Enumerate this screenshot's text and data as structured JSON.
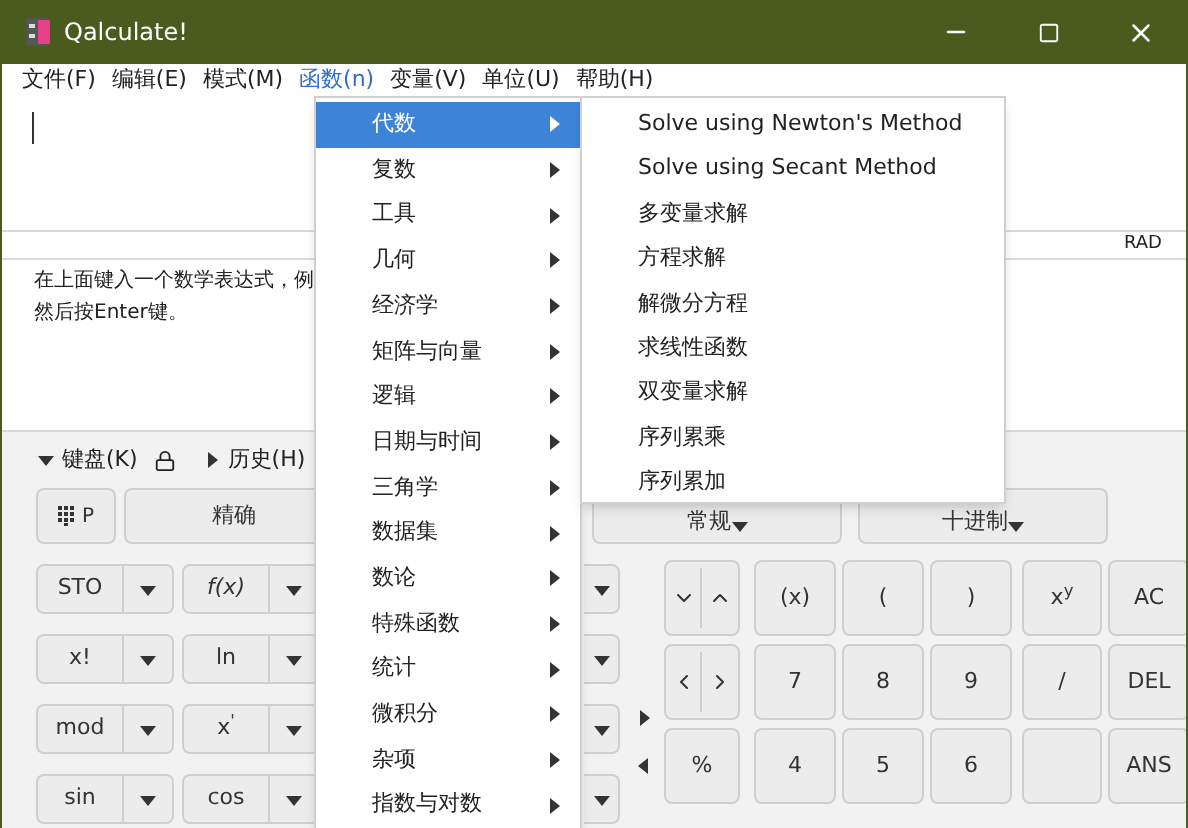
{
  "window": {
    "title": "Qalculate!"
  },
  "menu_bar": [
    {
      "label": "文件(F)",
      "selected": false
    },
    {
      "label": "编辑(E)",
      "selected": false
    },
    {
      "label": "模式(M)",
      "selected": false
    },
    {
      "label": "函数(n)",
      "selected": true
    },
    {
      "label": "变量(V)",
      "selected": false
    },
    {
      "label": "单位(U)",
      "selected": false
    },
    {
      "label": "帮助(H)",
      "selected": false
    }
  ],
  "status": {
    "angle": "RAD"
  },
  "result_hint": [
    "在上面键入一个数学表达式，例",
    "然后按Enter键。"
  ],
  "panel_toggles": [
    {
      "label": "键盘(K)",
      "expanded": true
    },
    {
      "label": "历史(H)",
      "expanded": false
    }
  ],
  "mode_buttons": [
    {
      "kind": "keypad",
      "label": "P"
    },
    {
      "kind": "text",
      "label": "精确"
    }
  ],
  "dropdowns": [
    "常规",
    "十进制"
  ],
  "function_keys": [
    {
      "cells": [
        {
          "label": "STO",
          "italic": false
        },
        {
          "label": "f(x)",
          "italic": true
        }
      ]
    },
    {
      "cells": [
        {
          "label": "x!",
          "italic": false
        },
        {
          "label": "ln",
          "italic": false
        }
      ]
    },
    {
      "cells": [
        {
          "label": "mod",
          "italic": false
        },
        {
          "label": "x$^{'}$",
          "italic": false
        }
      ]
    },
    {
      "cells": [
        {
          "label": "sin",
          "italic": false
        },
        {
          "label": "cos",
          "italic": false
        }
      ]
    }
  ],
  "keypad": [
    [
      {
        "kind": "nav_vertical"
      },
      {
        "kind": "key",
        "label": "(x)"
      },
      {
        "kind": "key",
        "label": "("
      },
      {
        "kind": "key",
        "label": ")"
      },
      {
        "kind": "key",
        "label": "x$^{y}$"
      },
      {
        "kind": "key",
        "label": "AC"
      }
    ],
    [
      {
        "kind": "nav_horizontal"
      },
      {
        "kind": "key",
        "label": "7"
      },
      {
        "kind": "key",
        "label": "8"
      },
      {
        "kind": "key",
        "label": "9"
      },
      {
        "kind": "key",
        "label": "/"
      },
      {
        "kind": "key",
        "label": "DEL"
      }
    ],
    [
      {
        "kind": "key",
        "label": "%"
      },
      {
        "kind": "key",
        "label": "4"
      },
      {
        "kind": "key",
        "label": "5"
      },
      {
        "kind": "key",
        "label": "6"
      },
      {
        "kind": "key"
      },
      {
        "kind": "key",
        "label": "ANS"
      }
    ]
  ],
  "function_menu": [
    {
      "label": "代数",
      "selected": true
    },
    {
      "label": "复数",
      "selected": false
    },
    {
      "label": "工具",
      "selected": false
    },
    {
      "label": "几何",
      "selected": false
    },
    {
      "label": "经济学",
      "selected": false
    },
    {
      "label": "矩阵与向量",
      "selected": false
    },
    {
      "label": "逻辑",
      "selected": false
    },
    {
      "label": "日期与时间",
      "selected": false
    },
    {
      "label": "三角学",
      "selected": false
    },
    {
      "label": "数据集",
      "selected": false
    },
    {
      "label": "数论",
      "selected": false
    },
    {
      "label": "特殊函数",
      "selected": false
    },
    {
      "label": "统计",
      "selected": false
    },
    {
      "label": "微积分",
      "selected": false
    },
    {
      "label": "杂项",
      "selected": false
    },
    {
      "label": "指数与对数",
      "selected": false
    }
  ],
  "submenu": [
    "Solve using Newton's Method",
    "Solve using Secant Method",
    "多变量求解",
    "方程求解",
    "解微分方程",
    "求线性函数",
    "双变量求解",
    "序列累乘",
    "序列累加"
  ]
}
